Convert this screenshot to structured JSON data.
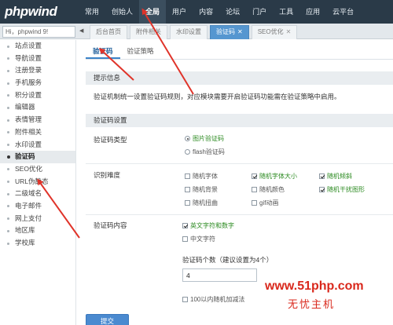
{
  "app": {
    "logo_main": "phpwind",
    "logo_accent": ""
  },
  "topnav": [
    {
      "label": "常用",
      "active": false
    },
    {
      "label": "创始人",
      "active": false
    },
    {
      "label": "全局",
      "active": true
    },
    {
      "label": "用户",
      "active": false
    },
    {
      "label": "内容",
      "active": false
    },
    {
      "label": "论坛",
      "active": false
    },
    {
      "label": "门户",
      "active": false
    },
    {
      "label": "工具",
      "active": false
    },
    {
      "label": "应用",
      "active": false
    },
    {
      "label": "云平台",
      "active": false
    }
  ],
  "search": {
    "value": "Hi，phpwind 9!"
  },
  "tabs": [
    {
      "label": "后台首页",
      "closable": false,
      "active": false
    },
    {
      "label": "附件相关",
      "closable": false,
      "active": false
    },
    {
      "label": "水印设置",
      "closable": false,
      "active": false
    },
    {
      "label": "验证码",
      "closable": true,
      "active": true
    },
    {
      "label": "SEO优化",
      "closable": true,
      "active": false
    }
  ],
  "sidebar": [
    {
      "label": "站点设置",
      "active": false
    },
    {
      "label": "导航设置",
      "active": false
    },
    {
      "label": "注册登录",
      "active": false
    },
    {
      "label": "手机服务",
      "active": false
    },
    {
      "label": "积分设置",
      "active": false
    },
    {
      "label": "编辑器",
      "active": false
    },
    {
      "label": "表情管理",
      "active": false
    },
    {
      "label": "附件相关",
      "active": false
    },
    {
      "label": "水印设置",
      "active": false
    },
    {
      "label": "验证码",
      "active": true
    },
    {
      "label": "SEO优化",
      "active": false
    },
    {
      "label": "URL伪静态",
      "active": false
    },
    {
      "label": "二级域名",
      "active": false
    },
    {
      "label": "电子邮件",
      "active": false
    },
    {
      "label": "网上支付",
      "active": false
    },
    {
      "label": "地区库",
      "active": false
    },
    {
      "label": "学校库",
      "active": false
    }
  ],
  "subtabs": [
    {
      "label": "验证码",
      "active": true
    },
    {
      "label": "验证策略",
      "active": false
    }
  ],
  "tip": {
    "title": "提示信息",
    "text": "验证机制统一设置验证码规则，对应模块需要开启验证码功能需在验证策略中启用。"
  },
  "settings": {
    "title": "验证码设置",
    "type": {
      "label": "验证码类型",
      "options": [
        {
          "label": "图片验证码",
          "checked": true
        },
        {
          "label": "flash验证码",
          "checked": false
        }
      ]
    },
    "difficulty": {
      "label": "识别难度",
      "options": [
        {
          "label": "随机字体",
          "checked": false
        },
        {
          "label": "随机字体大小",
          "checked": true
        },
        {
          "label": "随机倾斜",
          "checked": true
        },
        {
          "label": "随机背景",
          "checked": false
        },
        {
          "label": "随机颜色",
          "checked": false
        },
        {
          "label": "随机干扰图形",
          "checked": true
        },
        {
          "label": "随机扭曲",
          "checked": false
        },
        {
          "label": "gif动画",
          "checked": false
        }
      ]
    },
    "content": {
      "label": "验证码内容",
      "options": [
        {
          "label": "英文字符和数字",
          "checked": true
        },
        {
          "label": "中文字符",
          "checked": false
        }
      ]
    },
    "count": {
      "label": "验证码个数（建议设置为4个）",
      "value": "4"
    },
    "math": {
      "label": "100以内随机加减法",
      "checked": false
    }
  },
  "submit": {
    "label": "提交"
  },
  "watermark": {
    "url": "www.51php.com",
    "name": "无忧主机"
  },
  "colors": {
    "topbar": "#2a3a48",
    "accent": "#5596d0",
    "checked_text": "#2b8a20",
    "arrow": "#e0342a"
  }
}
